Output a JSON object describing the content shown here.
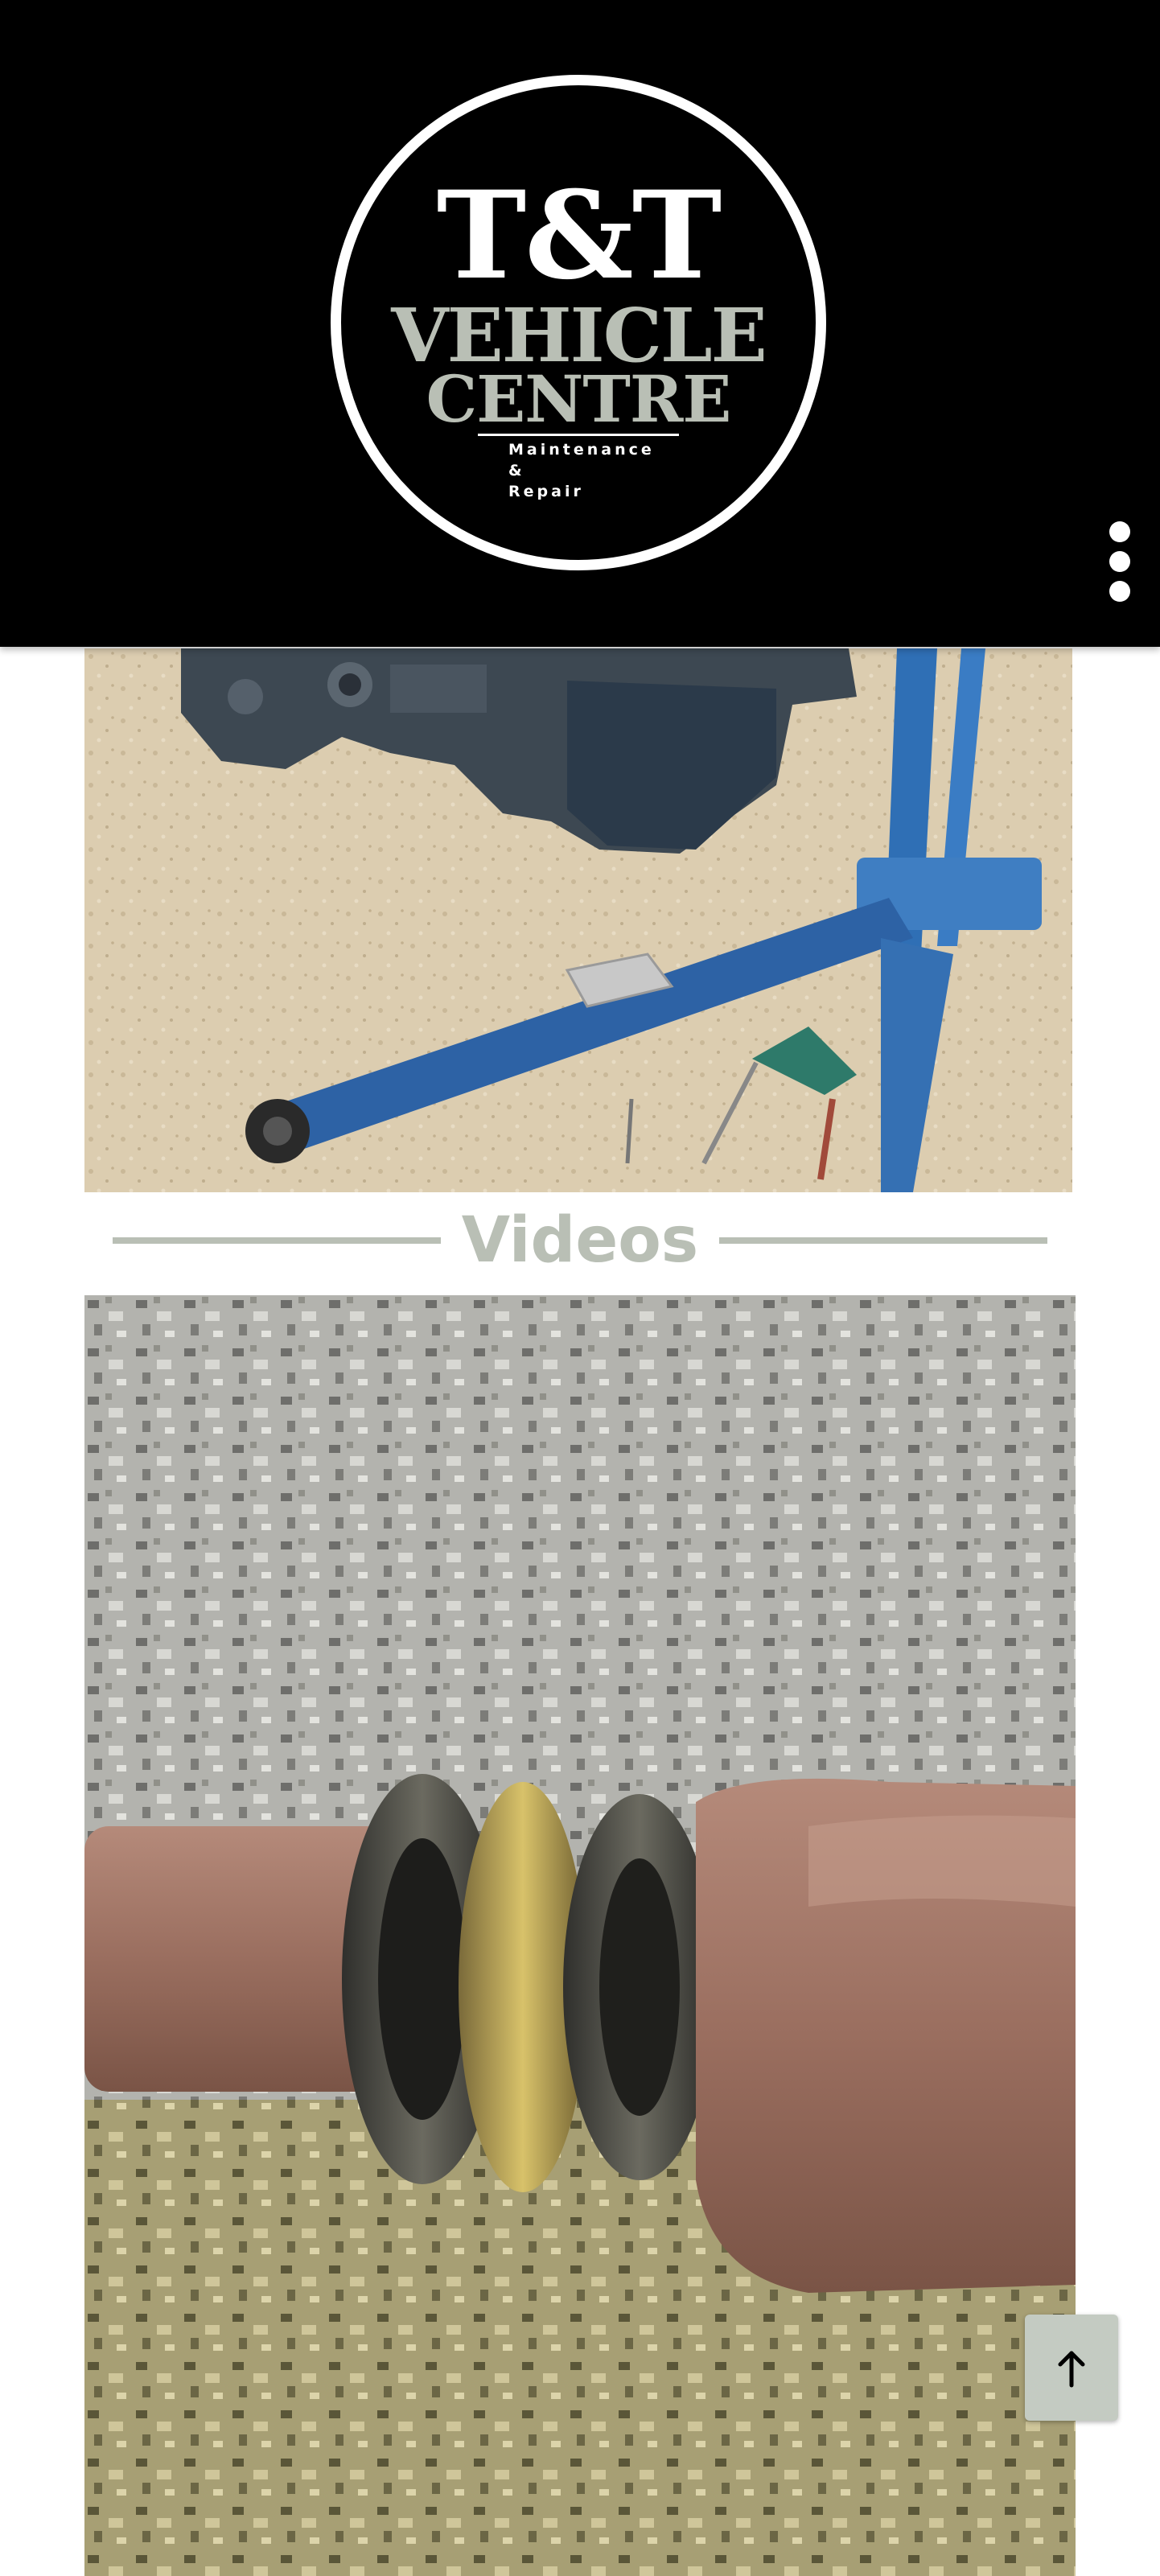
{
  "header": {
    "logo": {
      "line1": "T&T",
      "line2": "VEHICLE",
      "line3": "CENTRE",
      "tagline": "Maintenance &\nRepair"
    },
    "menu_icon": "more-vertical-icon"
  },
  "gallery": {
    "photo_subject": "engine-hoist-photo"
  },
  "videos": {
    "title": "Videos"
  },
  "scroll_top": {
    "icon": "arrow-up-icon"
  },
  "colors": {
    "header_bg": "#000000",
    "accent_sage": "#b9bfb5",
    "scroll_button_bg": "#c4cbc2"
  }
}
